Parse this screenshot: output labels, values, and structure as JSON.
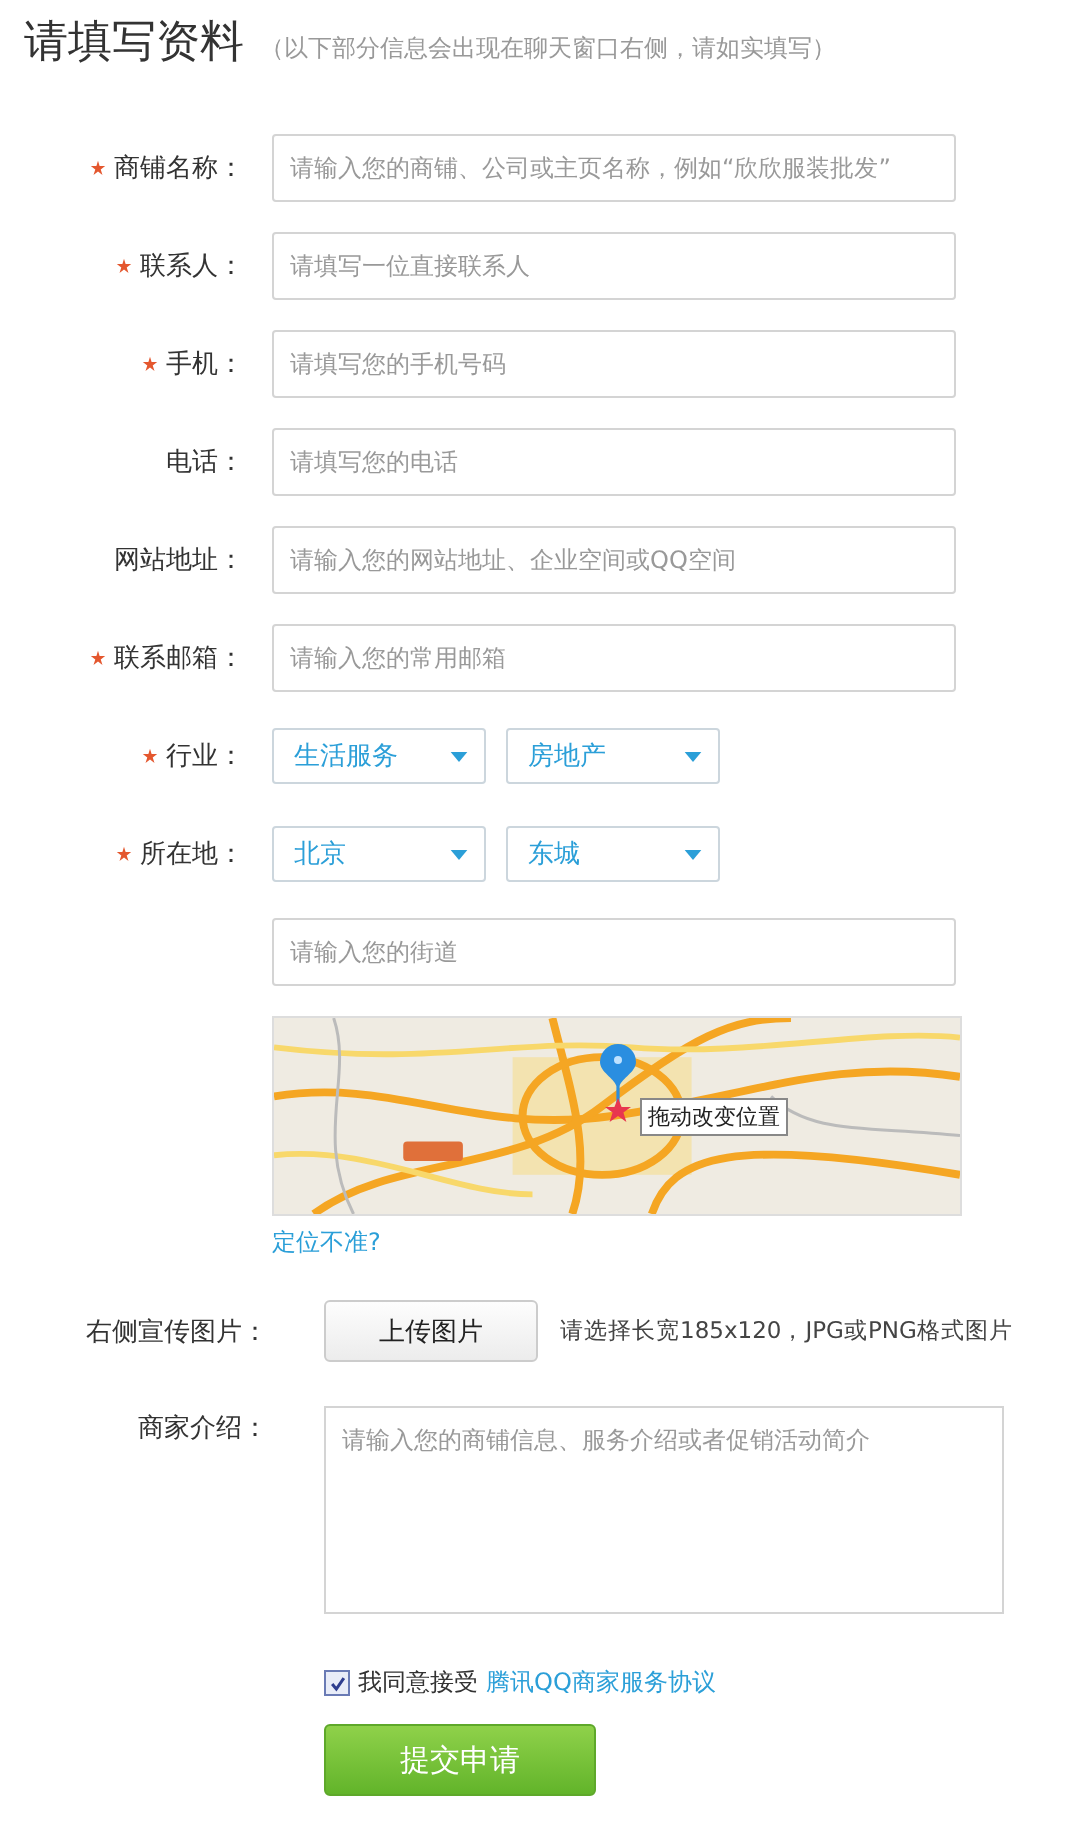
{
  "title": "请填写资料",
  "subtitle": "（以下部分信息会出现在聊天窗口右侧，请如实填写）",
  "rows": [
    {
      "kind": "input",
      "label": "商铺名称：",
      "required": true,
      "placeholder": "请输入您的商铺、公司或主页名称，例如“欣欣服装批发”"
    },
    {
      "kind": "input",
      "label": "联系人：",
      "required": true,
      "placeholder": "请填写一位直接联系人"
    },
    {
      "kind": "input",
      "label": "手机：",
      "required": true,
      "placeholder": "请填写您的手机号码"
    },
    {
      "kind": "input",
      "label": "电话：",
      "required": false,
      "placeholder": "请填写您的电话"
    },
    {
      "kind": "input",
      "label": "网站地址：",
      "required": false,
      "placeholder": "请输入您的网站地址、企业空间或QQ空间"
    },
    {
      "kind": "input",
      "label": "联系邮箱：",
      "required": true,
      "placeholder": "请输入您的常用邮箱"
    },
    {
      "kind": "selects",
      "label": "行业：",
      "required": true,
      "values": [
        "生活服务",
        "房地产"
      ]
    },
    {
      "kind": "selects",
      "label": "所在地：",
      "required": true,
      "values": [
        "北京",
        "东城"
      ]
    },
    {
      "kind": "input",
      "required": false,
      "placeholder": "请输入您的街道"
    }
  ],
  "map": {
    "kind": "picture",
    "tooltip": "拖动改变位置"
  },
  "locate_link": "定位不准?",
  "upload": {
    "label": "右侧宣传图片：",
    "button": "上传图片",
    "hint": "请选择长宽185x120，JPG或PNG格式图片"
  },
  "intro": {
    "label": "商家介绍：",
    "placeholder": "请输入您的商铺信息、服务介绍或者促销活动简介"
  },
  "agreement": {
    "checked": true,
    "text": "我同意接受",
    "link": "腾讯QQ商家服务协议"
  },
  "submit": "提交申请"
}
